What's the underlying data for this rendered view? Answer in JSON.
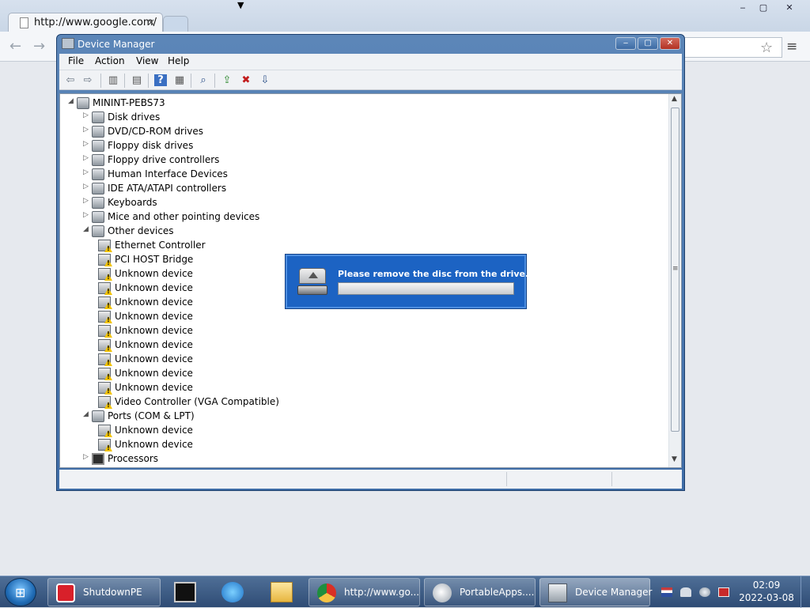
{
  "browser": {
    "tab_title": "http://www.google.com/",
    "tab_close": "×",
    "controls": {
      "minimize": "‒",
      "maximize": "▢",
      "close": "✕"
    },
    "back_icon": "←",
    "forward_icon": "→",
    "star_icon": "☆",
    "menu_icon": "≡"
  },
  "device_manager": {
    "title": "Device Manager",
    "controls": {
      "minimize": "‒",
      "maximize": "▢",
      "close": "✕"
    },
    "menus": [
      "File",
      "Action",
      "View",
      "Help"
    ],
    "toolbar": {
      "back": "⇦",
      "forward": "⇨",
      "console_tree": "▥",
      "properties": "▤",
      "help": "?",
      "action_pane": "▦",
      "scan": "⌕",
      "update_driver": "⇪",
      "uninstall": "✖",
      "disable": "⇩"
    },
    "tree": {
      "root": "MININT-PEBS73",
      "collapsed_glyph": "▷",
      "expanded_glyph": "◢",
      "categories": [
        {
          "label": "Disk drives",
          "expanded": false,
          "children": []
        },
        {
          "label": "DVD/CD-ROM drives",
          "expanded": false,
          "children": []
        },
        {
          "label": "Floppy disk drives",
          "expanded": false,
          "children": []
        },
        {
          "label": "Floppy drive controllers",
          "expanded": false,
          "children": []
        },
        {
          "label": "Human Interface Devices",
          "expanded": false,
          "children": []
        },
        {
          "label": "IDE ATA/ATAPI controllers",
          "expanded": false,
          "children": []
        },
        {
          "label": "Keyboards",
          "expanded": false,
          "children": []
        },
        {
          "label": "Mice and other pointing devices",
          "expanded": false,
          "children": []
        },
        {
          "label": "Other devices",
          "expanded": true,
          "children": [
            "Ethernet Controller",
            "PCI HOST Bridge",
            "Unknown device",
            "Unknown device",
            "Unknown device",
            "Unknown device",
            "Unknown device",
            "Unknown device",
            "Unknown device",
            "Unknown device",
            "Unknown device",
            "Video Controller (VGA Compatible)"
          ]
        },
        {
          "label": "Ports (COM & LPT)",
          "expanded": true,
          "children": [
            "Unknown device",
            "Unknown device"
          ]
        },
        {
          "label": "Processors",
          "expanded": false,
          "children": []
        }
      ]
    },
    "scroll": {
      "up": "▲",
      "down": "▼",
      "grip": "≡"
    }
  },
  "eject_dialog": {
    "message": "Please remove the disc from the drive."
  },
  "taskbar": {
    "start_glyph": "⊞",
    "buttons": [
      {
        "label": "ShutdownPE",
        "icon": "power-icon"
      },
      {
        "label": "http://www.go...",
        "icon": "chrome-icon"
      },
      {
        "label": "PortableApps....",
        "icon": "portableapps-icon"
      },
      {
        "label": "Device Manager",
        "icon": "device-manager-icon"
      }
    ],
    "pinned": [
      "cmd-icon",
      "network-globe-icon",
      "explorer-folder-icon"
    ],
    "tray": [
      "language-flag-icon",
      "network-icon",
      "volume-icon",
      "safely-remove-icon"
    ],
    "clock": {
      "time": "02:09",
      "date": "2022-03-08"
    }
  }
}
